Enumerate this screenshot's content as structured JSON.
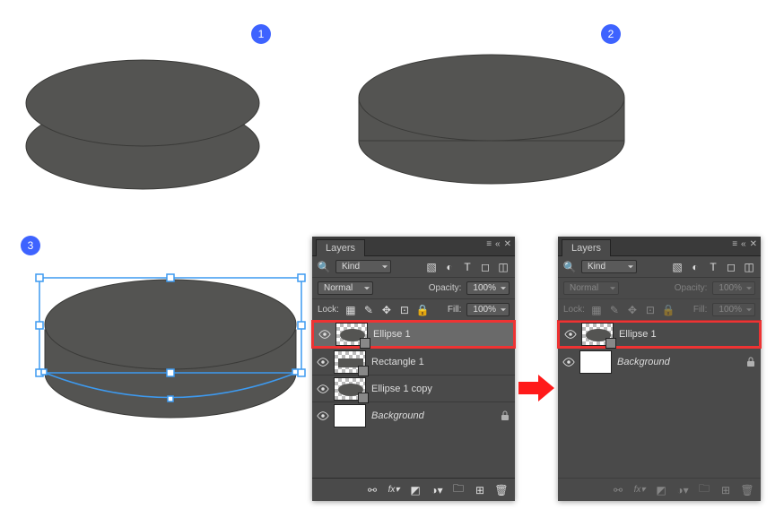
{
  "badges": {
    "one": "1",
    "two": "2",
    "three": "3"
  },
  "panel": {
    "title": "Layers",
    "search": "Kind",
    "blend": "Normal",
    "opacity_label": "Opacity:",
    "opacity_value": "100%",
    "lock_label": "Lock:",
    "fill_label": "Fill:",
    "fill_value": "100%"
  },
  "pA": {
    "layers": [
      {
        "name": "Ellipse 1"
      },
      {
        "name": "Rectangle 1"
      },
      {
        "name": "Ellipse 1 copy"
      },
      {
        "name": "Background"
      }
    ]
  },
  "pB": {
    "layers": [
      {
        "name": "Ellipse 1"
      },
      {
        "name": "Background"
      }
    ]
  }
}
